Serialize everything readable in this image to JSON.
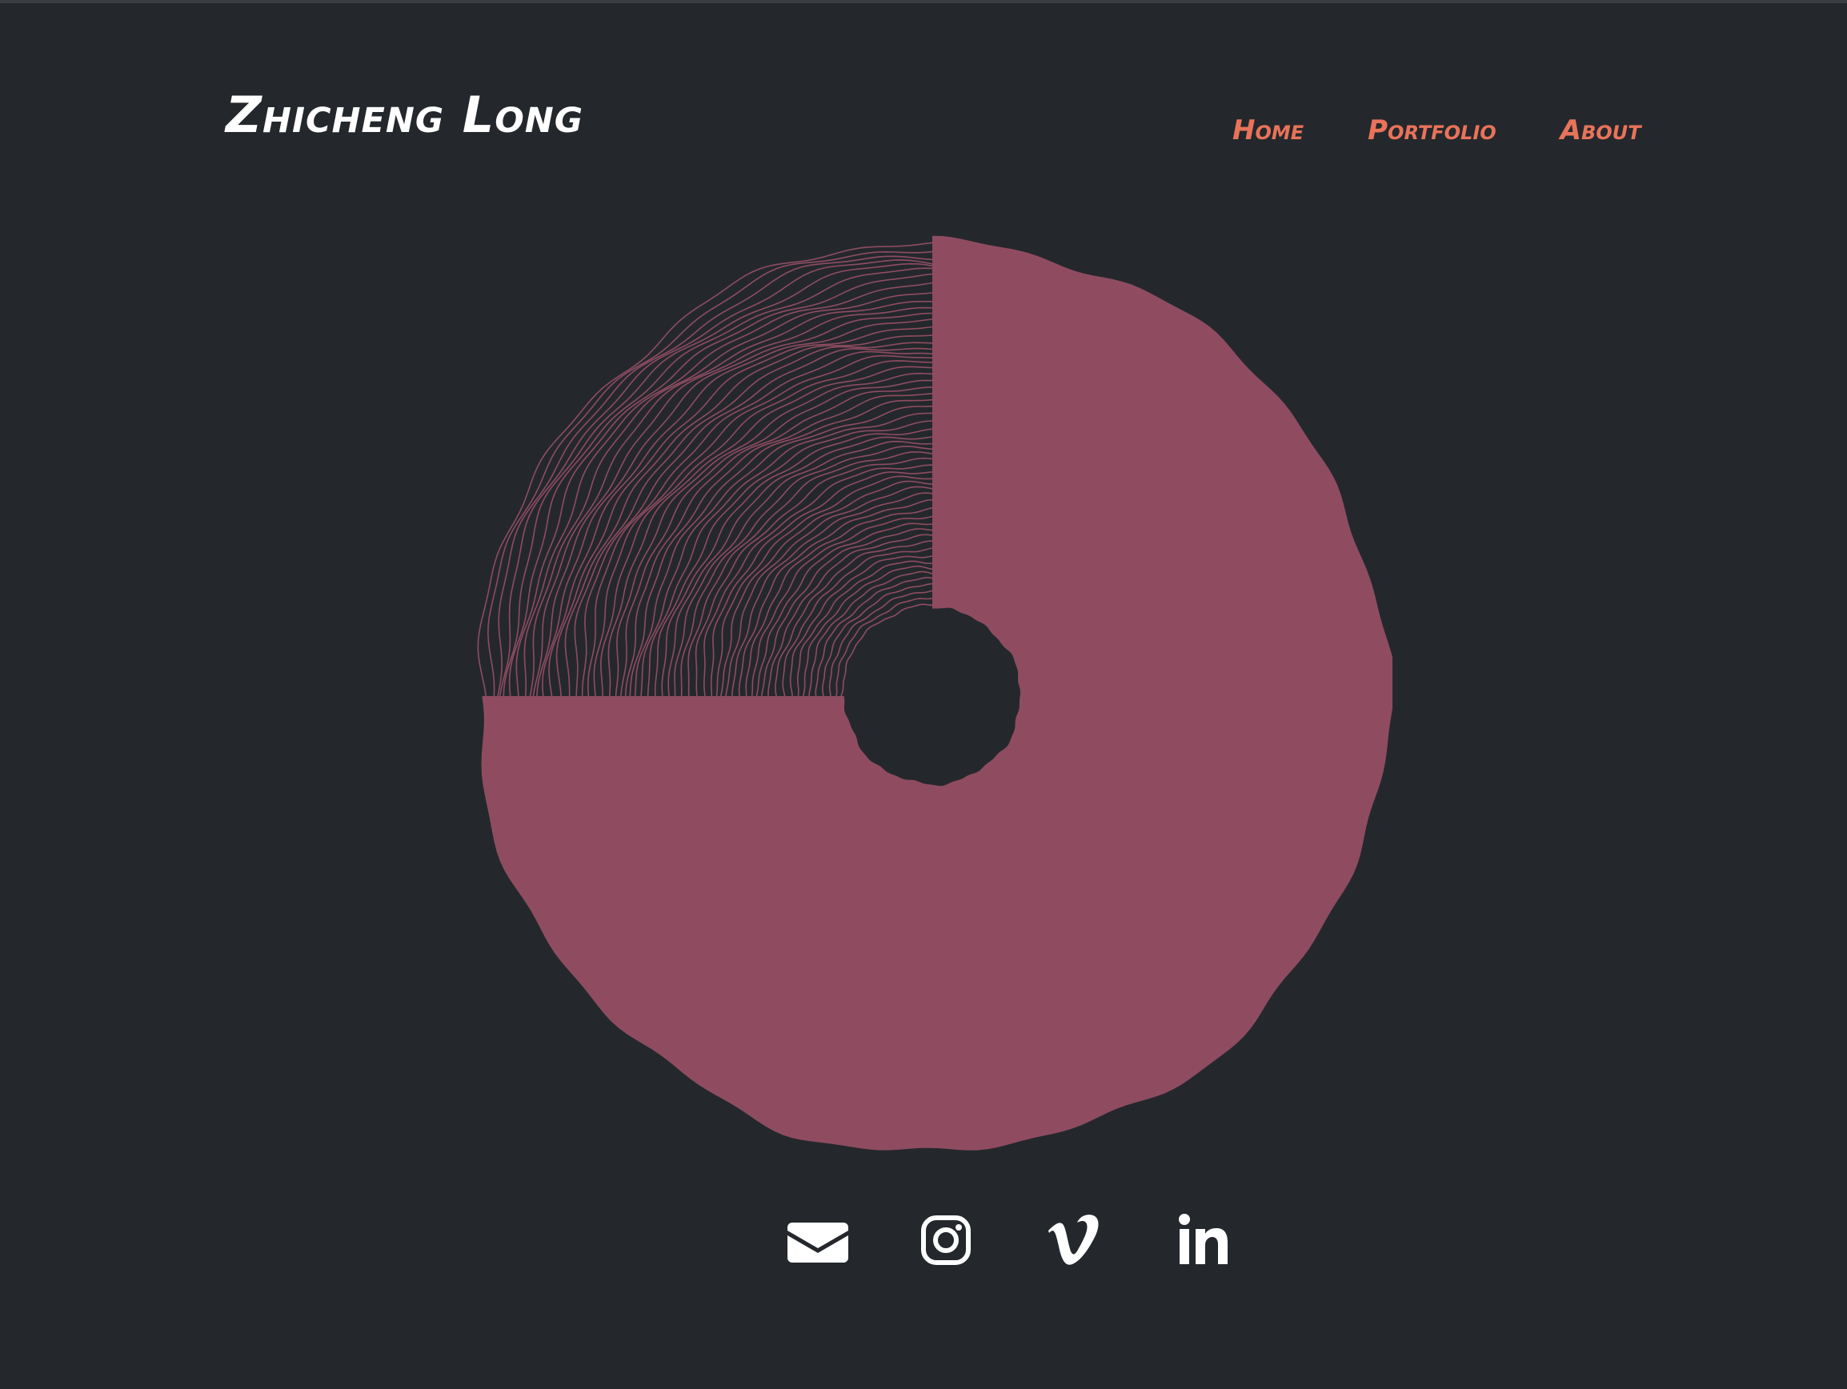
{
  "header": {
    "site_title": "Zhicheng Long"
  },
  "nav": {
    "items": [
      {
        "label": "Home"
      },
      {
        "label": "Portfolio"
      },
      {
        "label": "About"
      }
    ]
  },
  "artwork": {
    "fill_color": "#8f4c61",
    "line_color": "#8f4c61",
    "background_color": "#24282c"
  },
  "social": {
    "icons": [
      "envelope-icon",
      "instagram-icon",
      "vimeo-icon",
      "linkedin-icon"
    ]
  },
  "colors": {
    "background": "#24282c",
    "accent": "#e9735a",
    "title": "#ffffff",
    "icon": "#ffffff"
  }
}
